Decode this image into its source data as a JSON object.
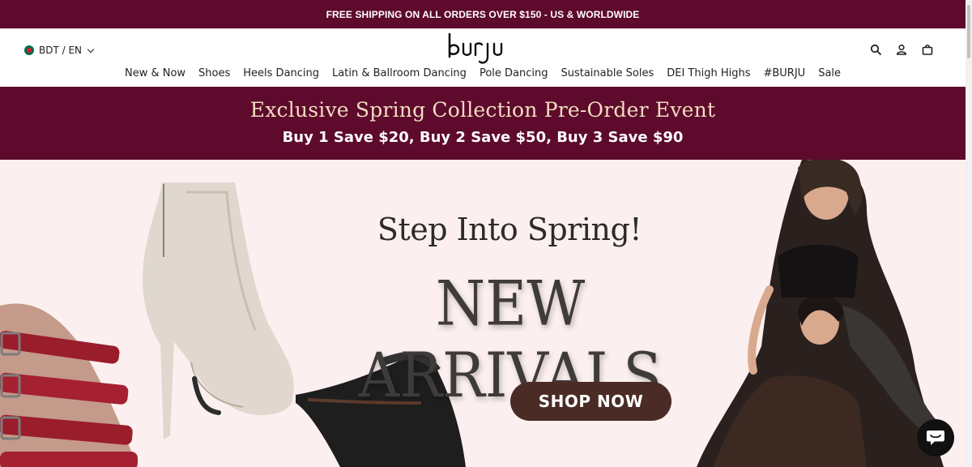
{
  "announcement": {
    "text": "FREE SHIPPING ON ALL ORDERS OVER $150 - US & WORLDWIDE"
  },
  "header": {
    "currency_label": "BDT / EN",
    "logo_text": "burju",
    "icons": [
      "search-icon",
      "account-icon",
      "cart-icon"
    ]
  },
  "nav": {
    "items": [
      {
        "label": "New & Now"
      },
      {
        "label": "Shoes"
      },
      {
        "label": "Heels Dancing"
      },
      {
        "label": "Latin & Ballroom Dancing"
      },
      {
        "label": "Pole Dancing"
      },
      {
        "label": "Sustainable Soles"
      },
      {
        "label": "DEI Thigh Highs"
      },
      {
        "label": "#BURJU"
      },
      {
        "label": "Sale"
      }
    ]
  },
  "promo": {
    "title": "Exclusive Spring Collection Pre-Order Event",
    "subtitle": "Buy 1 Save $20, Buy 2 Save $50, Buy 3 Save $90"
  },
  "hero": {
    "tagline": "Step Into Spring!",
    "title": "NEW ARRIVALS",
    "cta_label": "SHOP NOW"
  },
  "colors": {
    "brand": "#5d0a2c",
    "promo_title": "#f2dcc0",
    "hero_bg": "#fcefef",
    "cta_bg": "#4a2b25"
  }
}
